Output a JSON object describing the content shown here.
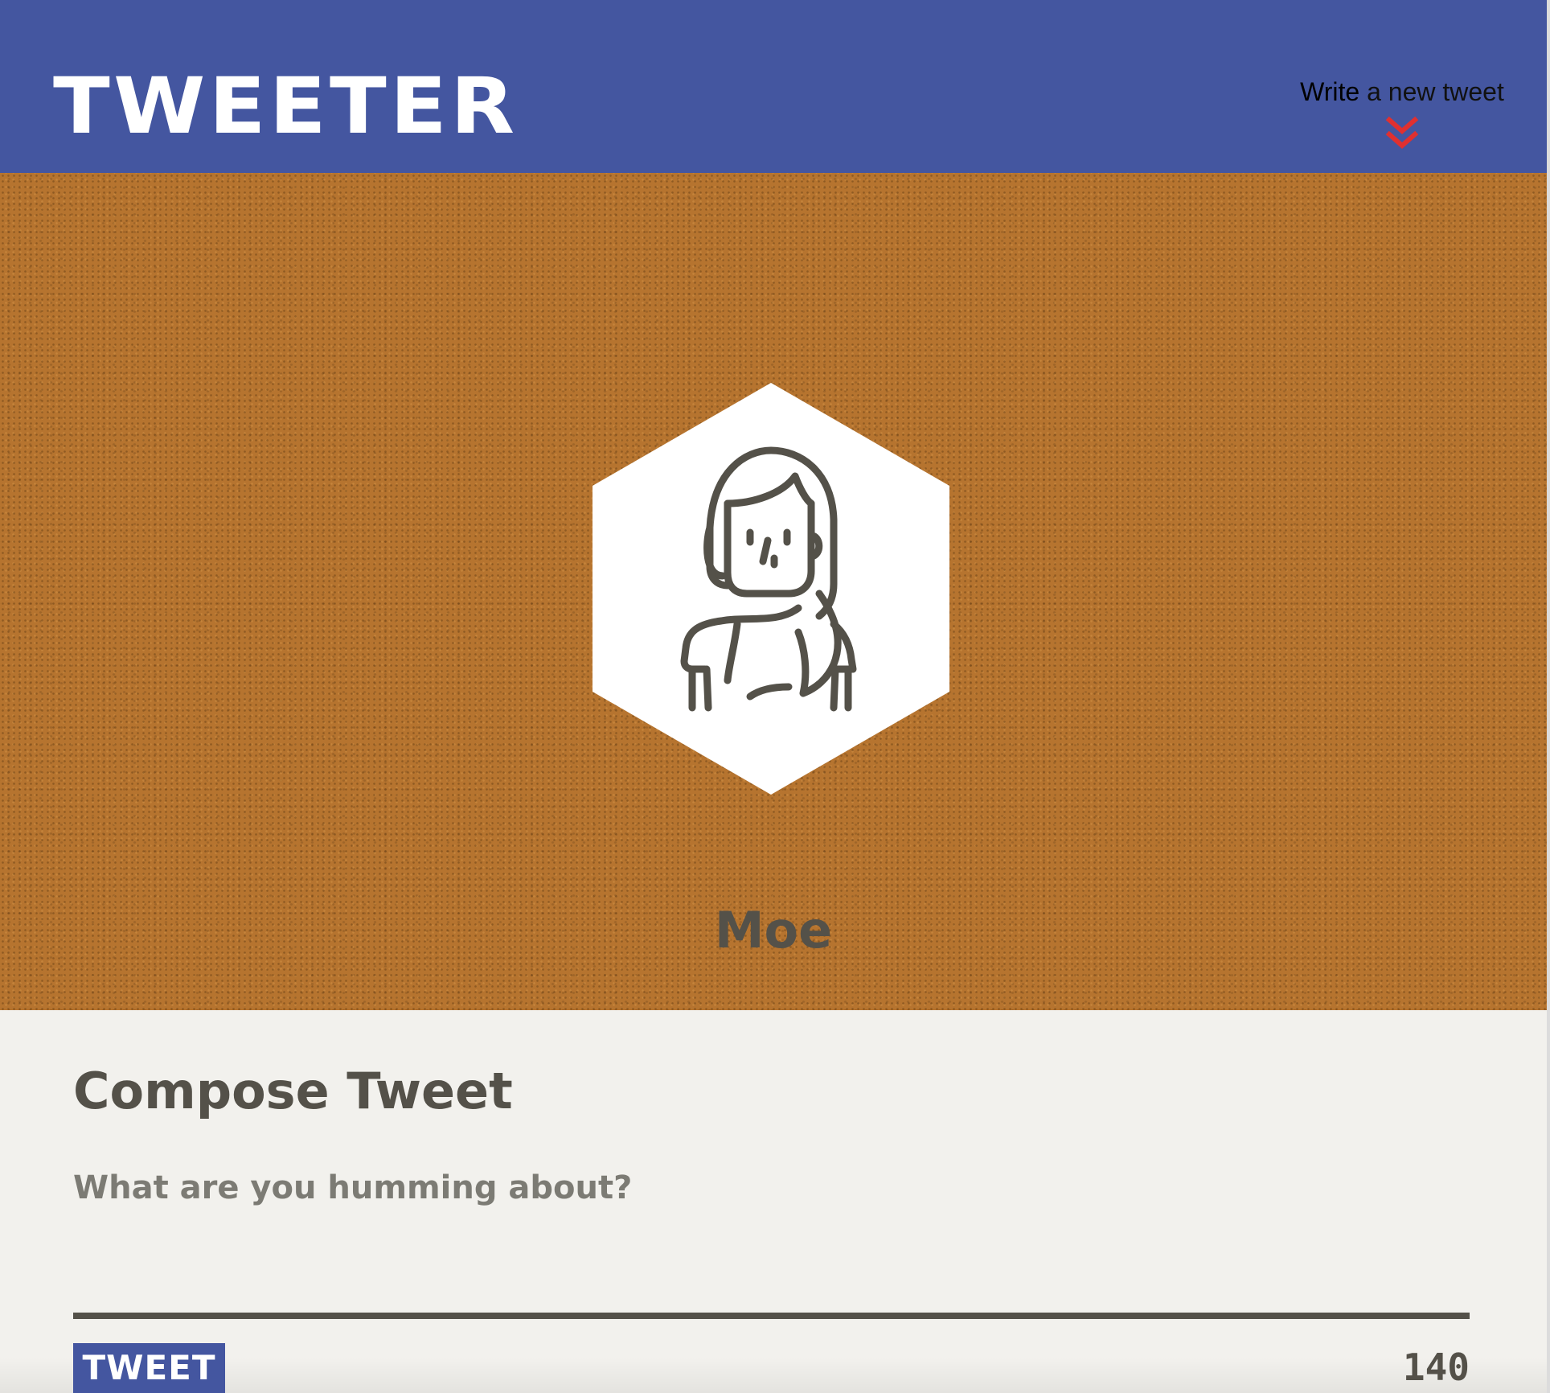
{
  "nav": {
    "logo": "TWEETER",
    "write_prefix": "Write",
    "write_suffix": " a new tweet",
    "chevron_icon": "double-chevron-down-icon",
    "chevron_color": "#e03030",
    "background": "#4456a0"
  },
  "profile": {
    "name": "Moe",
    "avatar_icon": "woman-avatar-icon",
    "background": "#b6742f"
  },
  "compose": {
    "title": "Compose Tweet",
    "placeholder": "What are you humming about?",
    "button_label": "TWEET",
    "char_count": "140"
  }
}
